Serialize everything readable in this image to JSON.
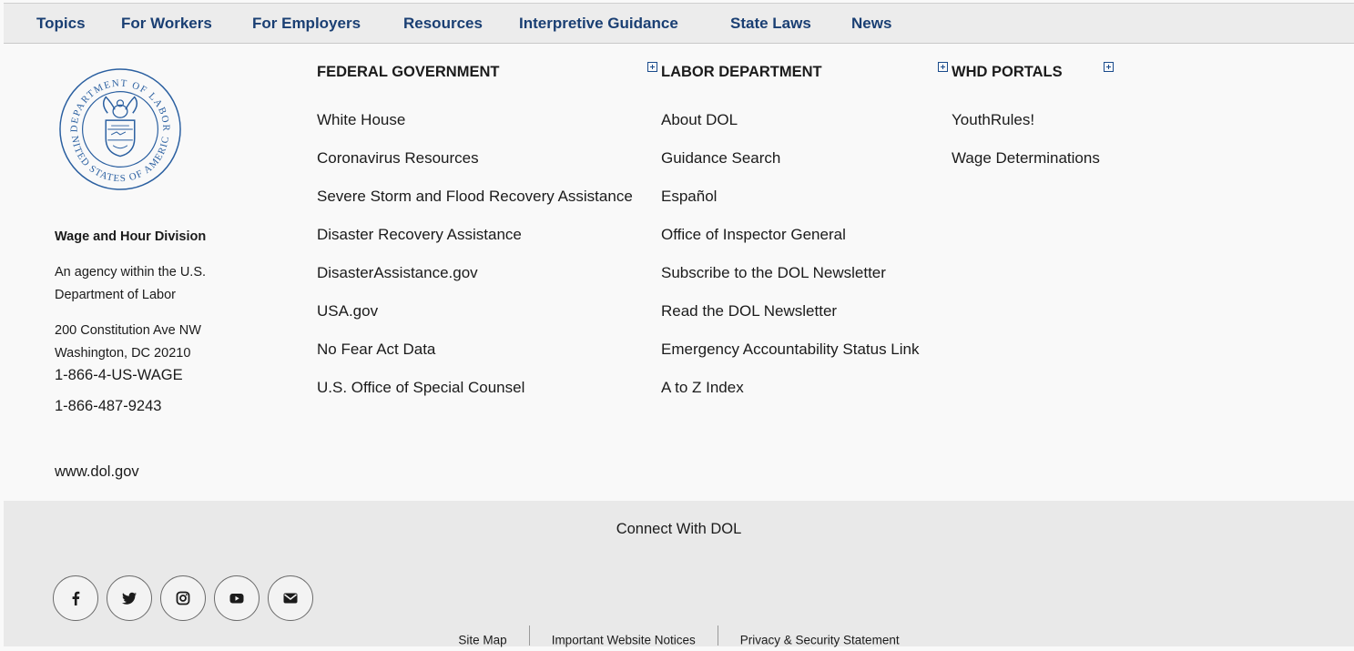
{
  "nav": {
    "items": [
      "Topics",
      "For Workers",
      "For Employers",
      "Resources",
      "Interpretive Guidance",
      "State Laws",
      "News"
    ]
  },
  "seal": {
    "top_text": "DEPARTMENT OF LABOR",
    "bottom_text": "UNITED STATES OF AMERICA"
  },
  "agency": {
    "name": "Wage and Hour Division",
    "desc_line1": "An agency within the U.S.",
    "desc_line2": "Department of Labor",
    "addr_line1": "200 Constitution Ave NW",
    "addr_line2": "Washington, DC 20210",
    "phone1": "1-866-4-US-WAGE",
    "phone2": "1-866-487-9243",
    "website": "www.dol.gov"
  },
  "columns": {
    "federal": {
      "heading": "FEDERAL GOVERNMENT",
      "links": [
        "White House",
        "Coronavirus Resources",
        "Severe Storm and Flood Recovery Assistance",
        "Disaster Recovery Assistance",
        "DisasterAssistance.gov",
        "USA.gov",
        "No Fear Act Data",
        "U.S. Office of Special Counsel"
      ]
    },
    "labor": {
      "heading": "LABOR DEPARTMENT",
      "links": [
        "About DOL",
        "Guidance Search",
        "Español",
        "Office of Inspector General",
        "Subscribe to the DOL Newsletter",
        "Read the DOL Newsletter",
        "Emergency Accountability Status Link",
        "A to Z Index"
      ]
    },
    "whd": {
      "heading": "WHD PORTALS",
      "links": [
        "YouthRules!",
        "Wage Determinations"
      ]
    }
  },
  "footer": {
    "connect": "Connect With DOL",
    "social": [
      "facebook-icon",
      "twitter-icon",
      "instagram-icon",
      "youtube-icon",
      "email-icon"
    ],
    "bottom_links": [
      "Site Map",
      "Important Website Notices",
      "Privacy & Security Statement"
    ]
  },
  "colors": {
    "nav_text": "#1a3f73",
    "accent": "#1a4b8c",
    "seal": "#2a5fa0"
  }
}
